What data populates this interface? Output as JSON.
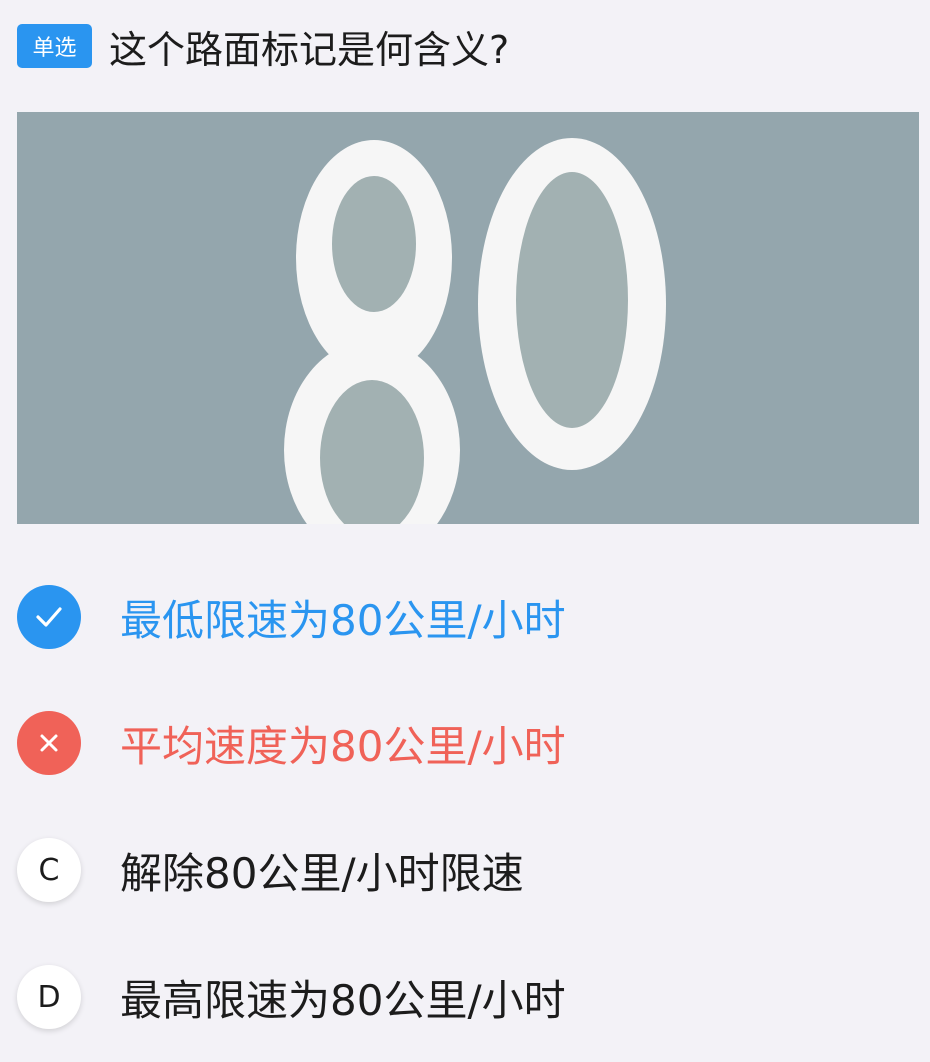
{
  "question": {
    "type_label": "单选",
    "text": "这个路面标记是何含义?"
  },
  "image": {
    "marking_text": "80",
    "background_color": "#94a6ad",
    "marking_color": "#f6f6f6"
  },
  "options": [
    {
      "marker": "check-icon",
      "state": "selected-correct",
      "text": "最低限速为80公里/小时",
      "color": "#2a95f0"
    },
    {
      "marker": "cross-icon",
      "state": "selected-wrong",
      "text": "平均速度为80公里/小时",
      "color": "#f06258"
    },
    {
      "marker": "C",
      "state": "unselected",
      "text": "解除80公里/小时限速"
    },
    {
      "marker": "D",
      "state": "unselected",
      "text": "最高限速为80公里/小时"
    }
  ],
  "colors": {
    "accent": "#2a95f0",
    "error": "#f06258",
    "background": "#f3f2f7"
  }
}
